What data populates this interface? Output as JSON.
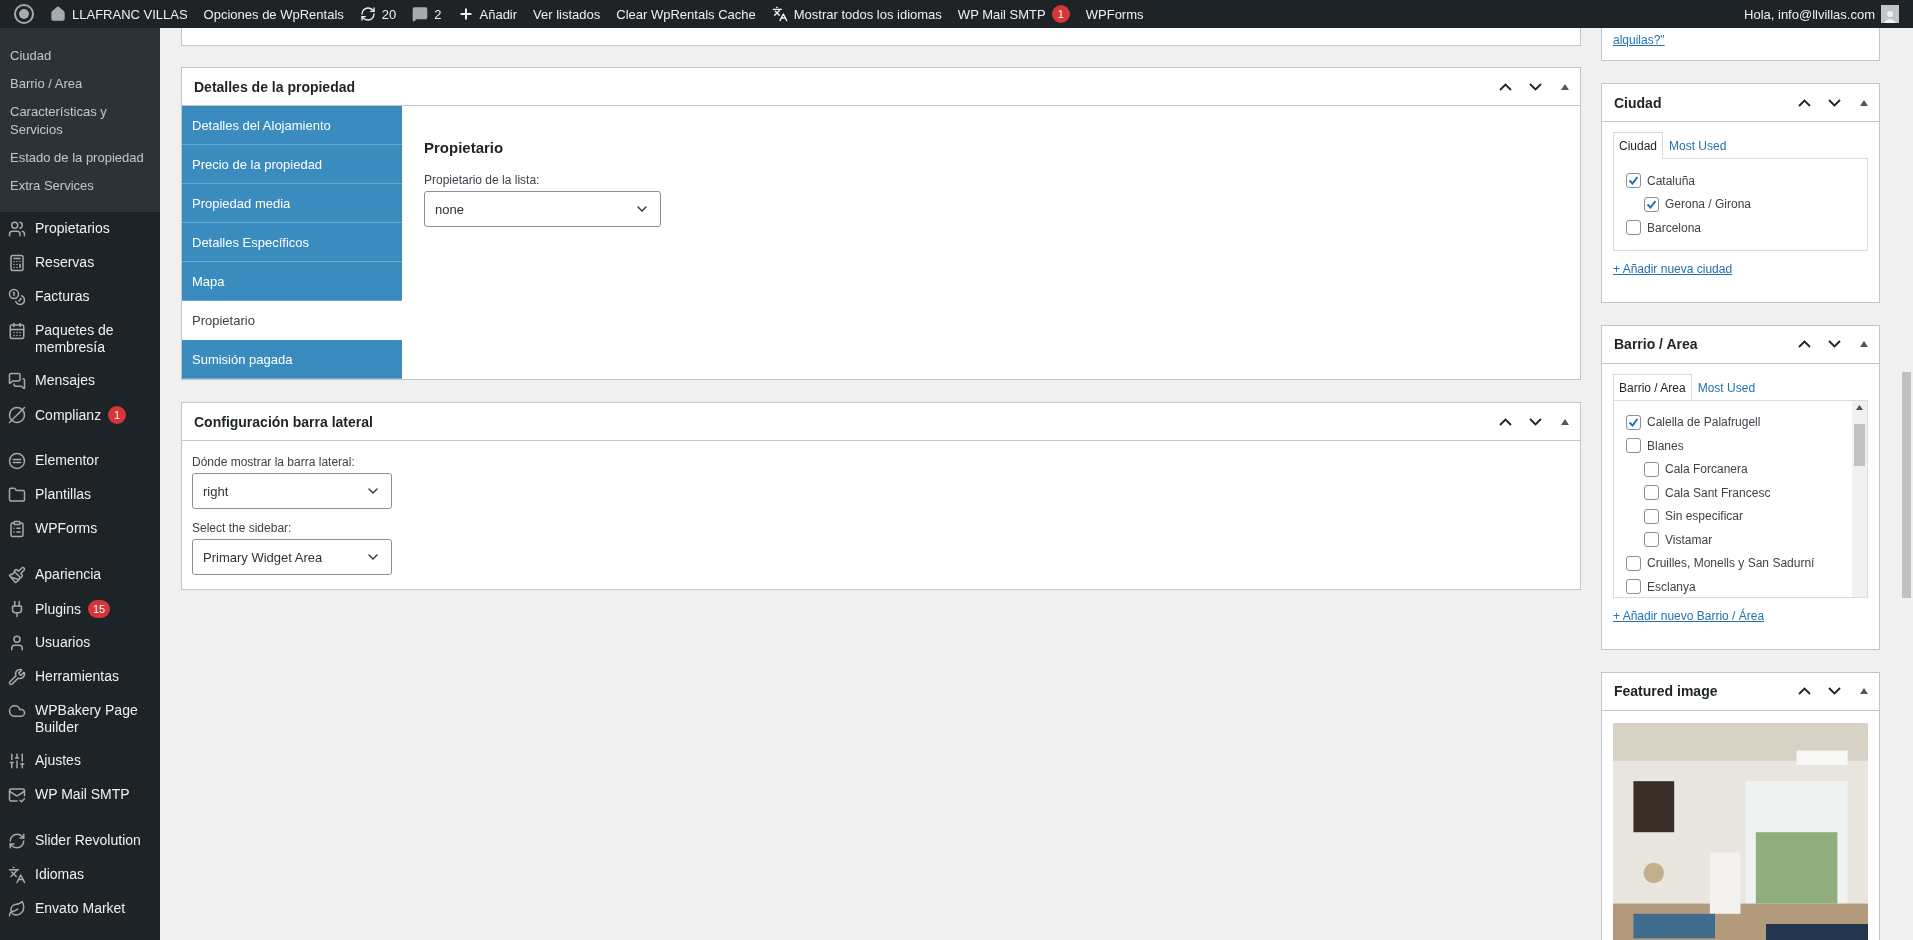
{
  "admin_bar": {
    "site_name": "LLAFRANC VILLAS",
    "items": [
      {
        "kind": "text",
        "label": "Opciones de WpRentals"
      },
      {
        "kind": "updates",
        "label": "20"
      },
      {
        "kind": "comments",
        "label": "2"
      },
      {
        "kind": "new",
        "label": "Añadir"
      },
      {
        "kind": "text",
        "label": "Ver listados"
      },
      {
        "kind": "text",
        "label": "Clear WpRentals Cache"
      },
      {
        "kind": "languages",
        "label": "Mostrar todos los idiomas"
      },
      {
        "kind": "text",
        "label": "WP Mail SMTP",
        "badge": "1"
      },
      {
        "kind": "text",
        "label": "WPForms"
      }
    ],
    "greeting": "Hola, info@llvillas.com"
  },
  "sidebar": {
    "submenu": [
      "Ciudad",
      "Barrio / Area",
      "Características y Servicios",
      "Estado de la propiedad",
      "Extra Services"
    ],
    "groups": [
      {
        "items": [
          {
            "label": "Propietarios"
          },
          {
            "label": "Reservas"
          },
          {
            "label": "Facturas"
          },
          {
            "label": "Paquetes de membresía"
          },
          {
            "label": "Mensajes"
          },
          {
            "label": "Complianz",
            "badge": "1"
          }
        ]
      },
      {
        "items": [
          {
            "label": "Elementor"
          },
          {
            "label": "Plantillas"
          },
          {
            "label": "WPForms"
          }
        ]
      },
      {
        "items": [
          {
            "label": "Apariencia"
          },
          {
            "label": "Plugins",
            "badge": "15"
          },
          {
            "label": "Usuarios"
          },
          {
            "label": "Herramientas"
          },
          {
            "label": "WPBakery Page Builder"
          },
          {
            "label": "Ajustes"
          },
          {
            "label": "WP Mail SMTP"
          }
        ]
      },
      {
        "items": [
          {
            "label": "Slider Revolution"
          },
          {
            "label": "Idiomas"
          },
          {
            "label": "Envato Market"
          }
        ]
      }
    ]
  },
  "property_details": {
    "title": "Detalles de la propiedad",
    "tabs": [
      {
        "label": "Detalles del Alojamiento",
        "selected": false
      },
      {
        "label": "Precio de la propiedad",
        "selected": false
      },
      {
        "label": "Propiedad media",
        "selected": false
      },
      {
        "label": "Detalles Específicos",
        "selected": false
      },
      {
        "label": "Mapa",
        "selected": false
      },
      {
        "label": "Propietario",
        "selected": true
      },
      {
        "label": "Sumisión pagada",
        "selected": false
      }
    ],
    "section_title": "Propietario",
    "owner_label": "Propietario de la lista:",
    "owner_value": "none"
  },
  "sidebar_config": {
    "title": "Configuración barra lateral",
    "fields": [
      {
        "label": "Dónde mostrar la barra lateral:",
        "value": "right"
      },
      {
        "label": "Select the sidebar:",
        "value": "Primary Widget Area"
      }
    ]
  },
  "right_column": {
    "top_link": "alquilas?\"",
    "ciudad": {
      "title": "Ciudad",
      "tabs": [
        {
          "label": "Ciudad",
          "selected": true
        },
        {
          "label": "Most Used",
          "selected": false
        }
      ],
      "terms": [
        {
          "label": "Cataluña",
          "checked": true,
          "children": [
            {
              "label": "Gerona / Girona",
              "checked": true
            }
          ]
        },
        {
          "label": "Barcelona",
          "checked": false
        }
      ],
      "add_link": "+ Añadir nueva ciudad"
    },
    "barrio": {
      "title": "Barrio / Area",
      "tabs": [
        {
          "label": "Barrio / Area",
          "selected": true
        },
        {
          "label": "Most Used",
          "selected": false
        }
      ],
      "terms": [
        {
          "label": "Calella de Palafrugell",
          "checked": true
        },
        {
          "label": "Blanes",
          "checked": false,
          "children": [
            {
              "label": "Cala Forcanera",
              "checked": false
            },
            {
              "label": "Cala Sant Francesc",
              "checked": false
            },
            {
              "label": "Sin especificar",
              "checked": false
            },
            {
              "label": "Vistamar",
              "checked": false
            }
          ]
        },
        {
          "label": "Cruilles, Monells y San Sadurní",
          "checked": false
        },
        {
          "label": "Esclanya",
          "checked": false
        }
      ],
      "add_link": "+ Añadir nuevo Barrio / Área"
    },
    "featured_image": {
      "title": "Featured image"
    }
  }
}
